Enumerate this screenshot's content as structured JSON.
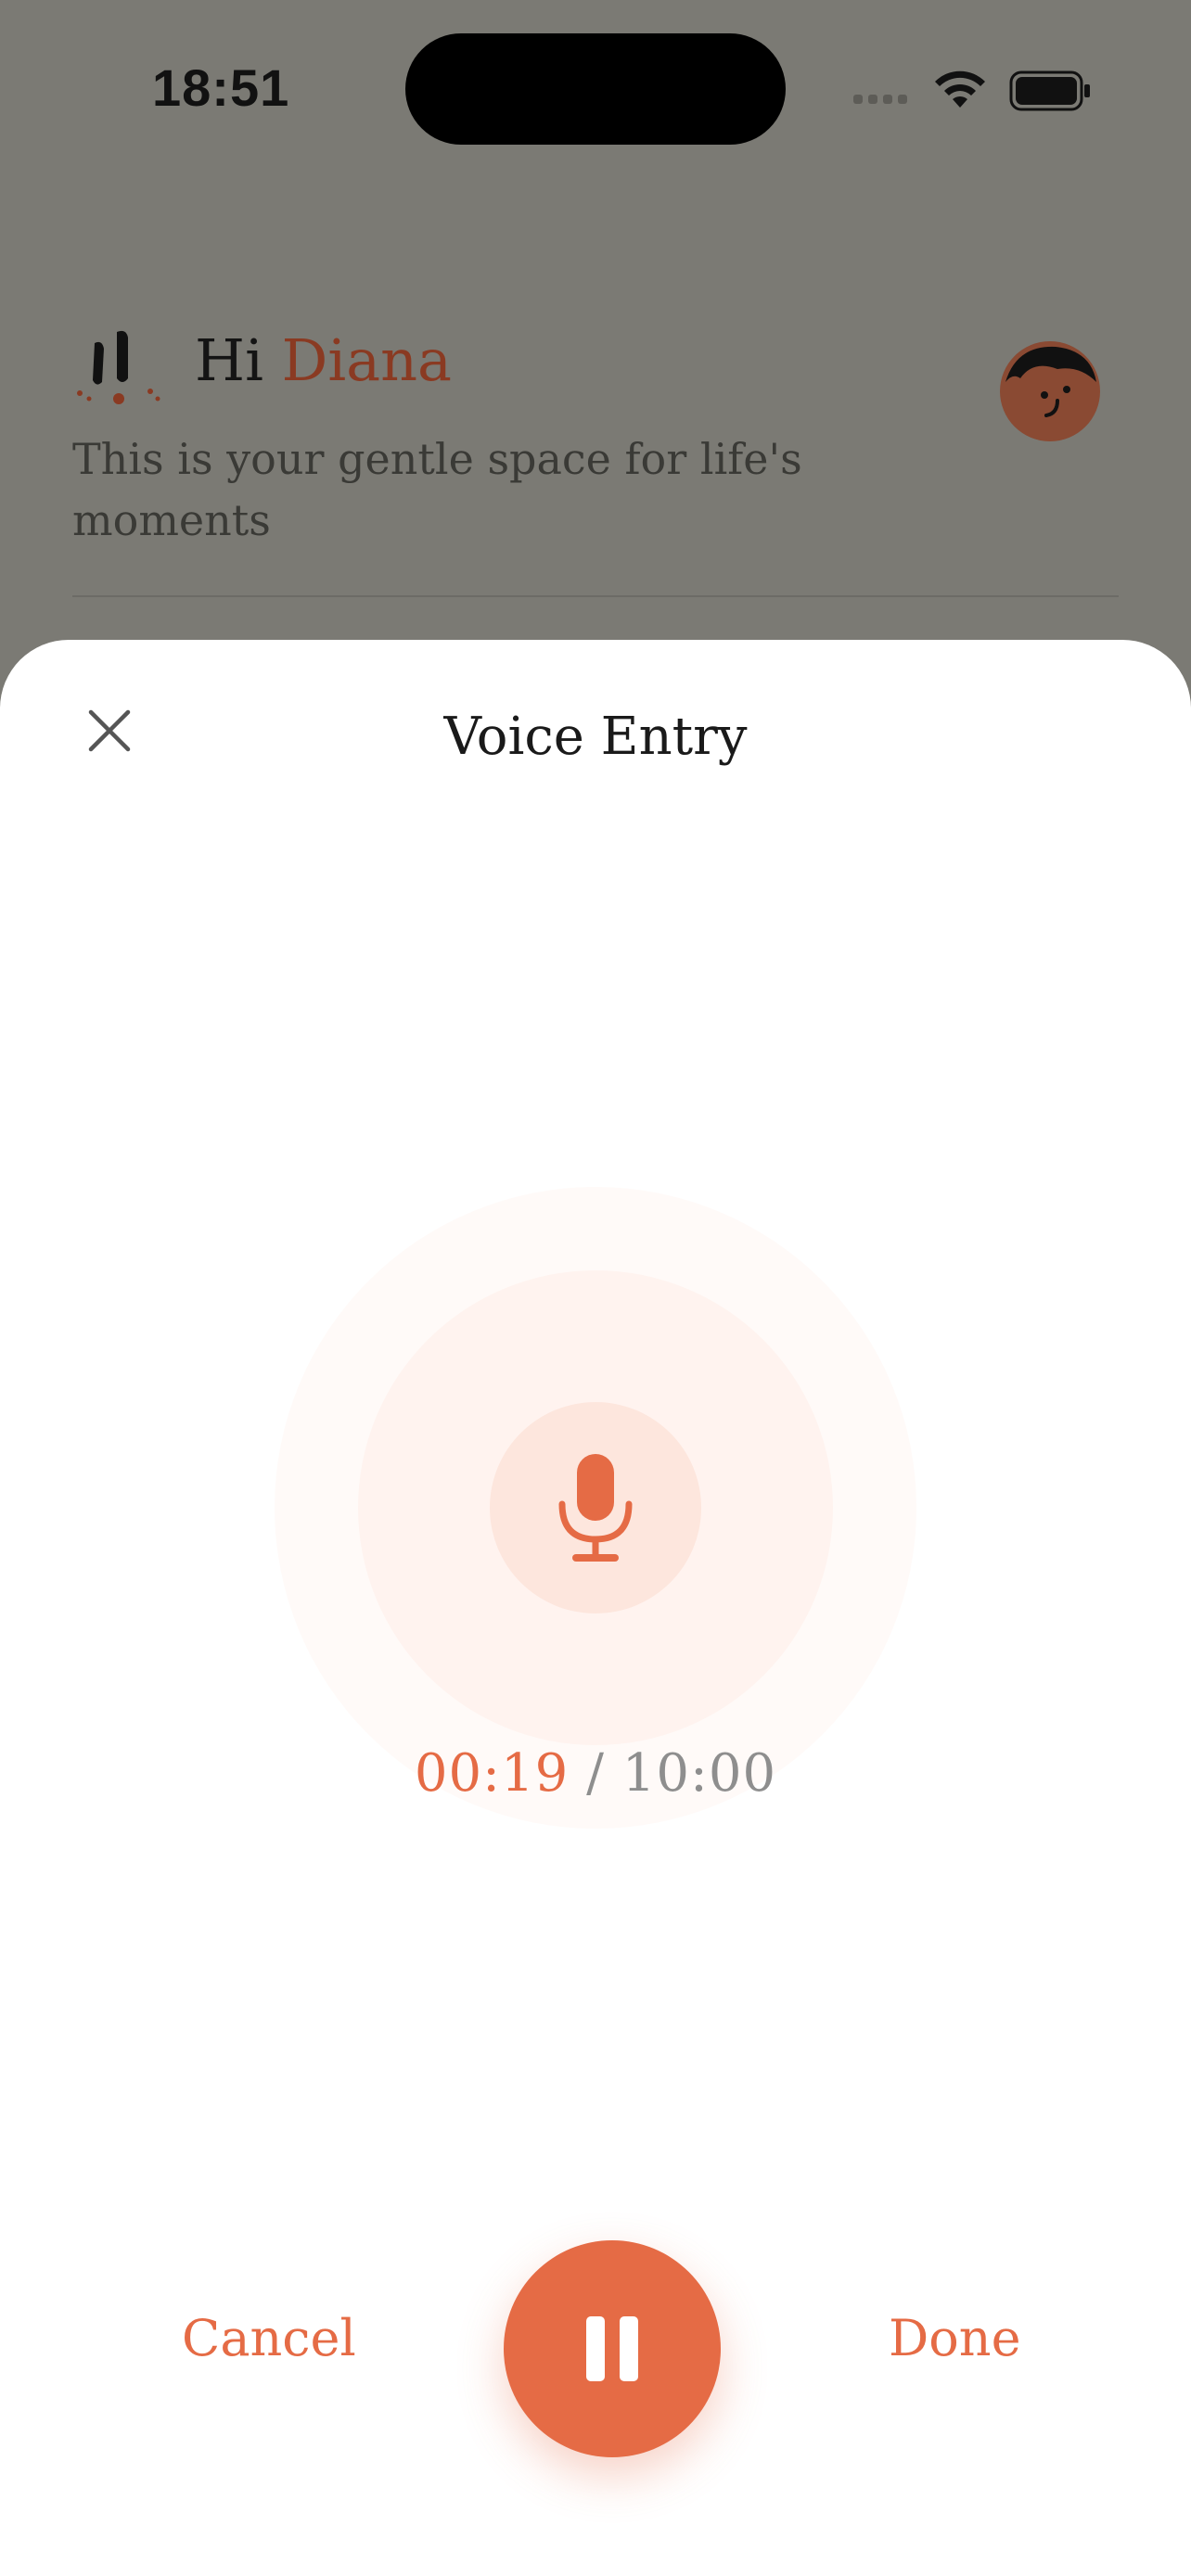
{
  "status_bar": {
    "time": "18:51"
  },
  "header": {
    "greeting_prefix": "Hi",
    "user_name": "Diana",
    "subtitle": "This is your gentle space for life's moments",
    "avatar_icon": "smiley-avatar-icon",
    "logo_icon": "brand-logo-icon"
  },
  "sheet": {
    "title": "Voice Entry",
    "close_icon": "close-icon",
    "mic_icon": "microphone-icon",
    "timer": {
      "elapsed": "00:19",
      "separator": "/",
      "total": "10:00"
    },
    "cancel_label": "Cancel",
    "done_label": "Done",
    "pause_icon": "pause-icon"
  },
  "colors": {
    "accent": "#e56b45",
    "name_accent": "#8a3a22",
    "overlay": "#7b7a74"
  }
}
